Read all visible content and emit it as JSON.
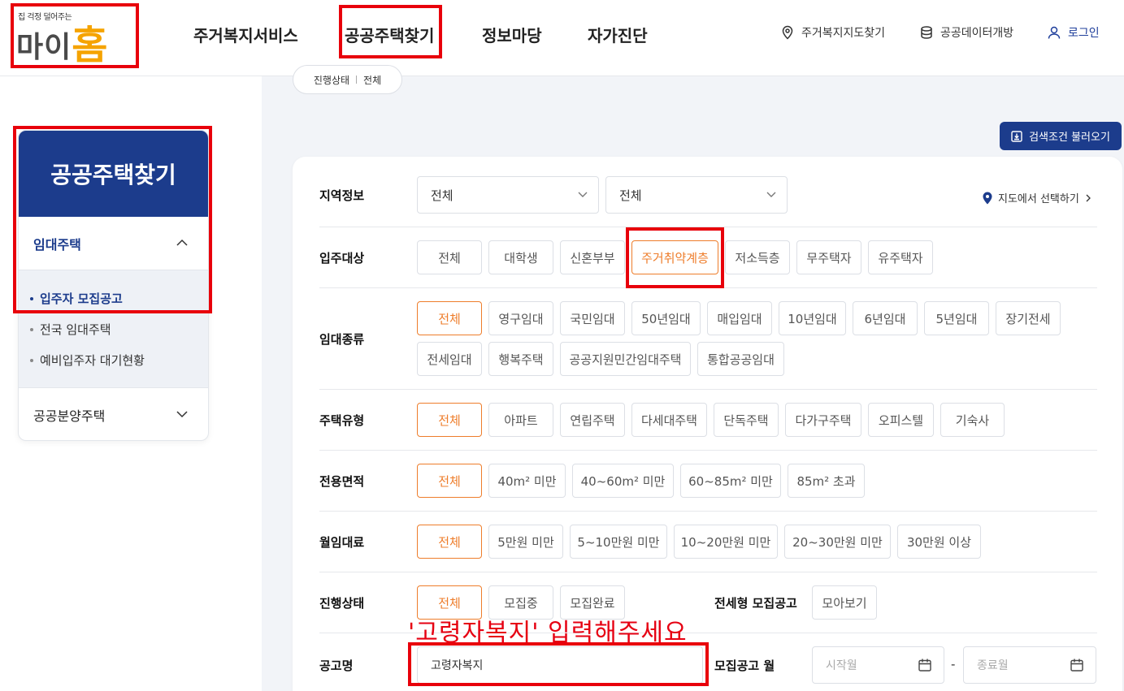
{
  "header": {
    "logo_tagline": "집 걱정 덜어주는",
    "logo_brand_main": "마이",
    "logo_brand_accent": "홈",
    "nav": [
      "주거복지서비스",
      "공공주택찾기",
      "정보마당",
      "자가진단"
    ],
    "util": {
      "map": "주거복지지도찾기",
      "data": "공공데이터개방",
      "login": "로그인"
    }
  },
  "sidebar": {
    "title": "공공주택찾기",
    "group1": "임대주택",
    "items": [
      "입주자 모집공고",
      "전국 임대주택",
      "예비입주자 대기현황"
    ],
    "group2": "공공분양주택"
  },
  "summary_pill": {
    "label": "진행상태",
    "value": "전체"
  },
  "load_button": "검색조건 불러오기",
  "filters": {
    "region": {
      "label": "지역정보",
      "select1": "전체",
      "select2": "전체",
      "map_link": "지도에서 선택하기"
    },
    "target": {
      "label": "입주대상",
      "options": [
        "전체",
        "대학생",
        "신혼부부",
        "주거취약계층",
        "저소득층",
        "무주택자",
        "유주택자"
      ],
      "selected": "주거취약계층"
    },
    "rental_type": {
      "label": "임대종류",
      "options": [
        "전체",
        "영구임대",
        "국민임대",
        "50년임대",
        "매입임대",
        "10년임대",
        "6년임대",
        "5년임대",
        "장기전세",
        "전세임대",
        "행복주택",
        "공공지원민간임대주택",
        "통합공공임대"
      ],
      "selected": "전체"
    },
    "house_type": {
      "label": "주택유형",
      "options": [
        "전체",
        "아파트",
        "연립주택",
        "다세대주택",
        "단독주택",
        "다가구주택",
        "오피스텔",
        "기숙사"
      ],
      "selected": "전체"
    },
    "area": {
      "label": "전용면적",
      "options": [
        "전체",
        "40m² 미만",
        "40~60m² 미만",
        "60~85m² 미만",
        "85m² 초과"
      ],
      "selected": "전체"
    },
    "rent": {
      "label": "월임대료",
      "options": [
        "전체",
        "5만원 미만",
        "5~10만원 미만",
        "10~20만원 미만",
        "20~30만원 미만",
        "30만원 이상"
      ],
      "selected": "전체"
    },
    "status": {
      "label": "진행상태",
      "options": [
        "전체",
        "모집중",
        "모집완료"
      ],
      "selected": "전체",
      "jeonse_label": "전세형 모집공고",
      "jeonse_button": "모아보기"
    },
    "notice": {
      "label": "공고명",
      "value": "고령자복지",
      "month_label": "모집공고 월",
      "start_placeholder": "시작월",
      "dash": "-",
      "end_placeholder": "종료월"
    }
  },
  "annotation": "'고령자복지' 입력해주세요",
  "colors": {
    "brand_blue": "#1c3c8c",
    "accent_orange": "#ee7d2b",
    "highlight_red": "#e8000b",
    "logo_orange": "#f5a300"
  }
}
